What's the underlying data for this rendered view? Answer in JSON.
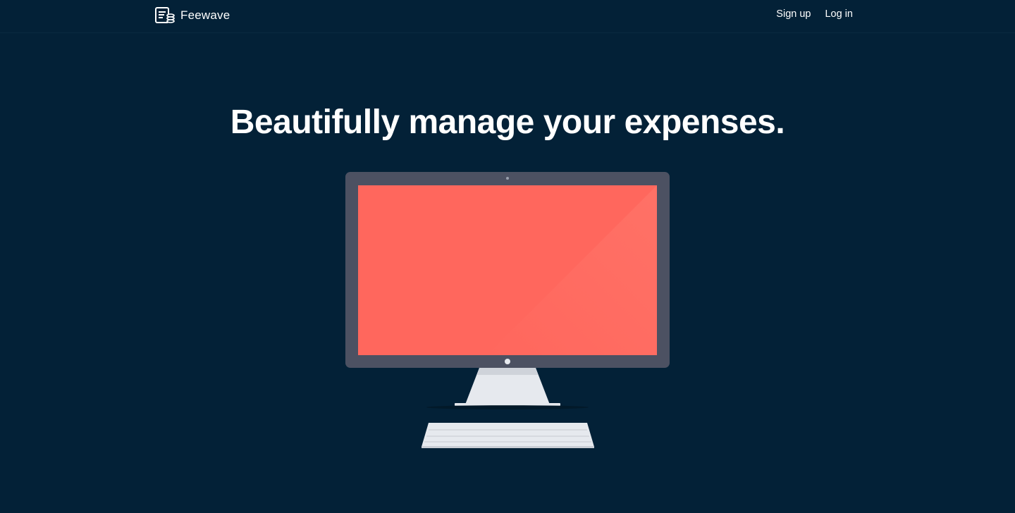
{
  "nav": {
    "brand": "Feewave",
    "brand_icon": "ledger-coins-icon",
    "links": [
      {
        "label": "Sign up"
      },
      {
        "label": "Log in"
      }
    ]
  },
  "hero": {
    "headline": "Beautifully manage your expenses."
  },
  "colors": {
    "background": "#032137",
    "screen": "#ff675d",
    "monitor_frame": "#4c5162",
    "stand": "#e6e9ee"
  }
}
